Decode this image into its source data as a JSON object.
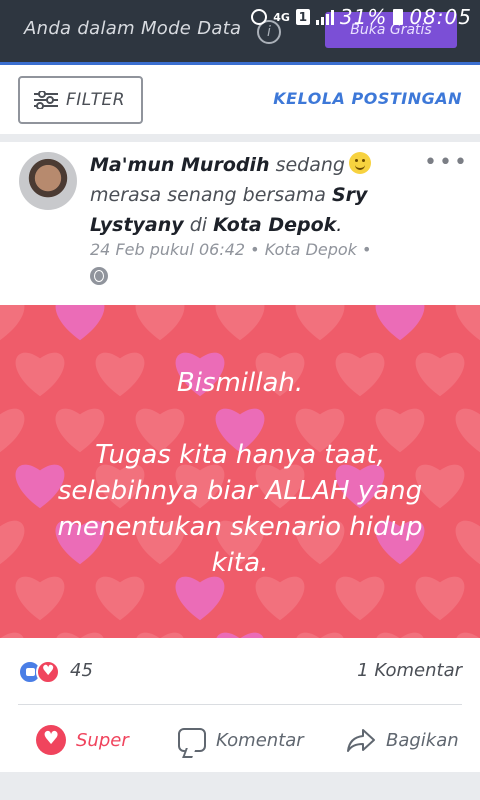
{
  "banner": {
    "mode_text": "Anda dalam Mode Data",
    "info_icon": "info-icon",
    "free_button": "Buka Gratis"
  },
  "status_bar": {
    "network": "4G",
    "sim": "1",
    "battery_percent": "31%",
    "time": "08:05"
  },
  "toolbar": {
    "filter_label": "FILTER",
    "manage_label": "KELOLA POSTINGAN"
  },
  "post": {
    "author": "Ma'mun Murodih",
    "activity_prefix": "sedang",
    "feeling_text": "merasa senang bersama",
    "tagged_person": "Sry Lystyany",
    "place_prefix": "di",
    "place": "Kota Depok",
    "period": ".",
    "meta": "24 Feb pukul 06:42 • Kota Depok •",
    "image_text": {
      "line1": "Bismillah.",
      "line2": "Tugas kita hanya taat,",
      "line3": "selebihnya biar ALLAH yang",
      "line4": "menentukan skenario hidup",
      "line5": "kita."
    },
    "image_colors": {
      "background": "#ef5c6a",
      "heart_red": "#f47a86",
      "heart_pink": "#ea6fc4"
    },
    "reaction_count": "45",
    "comment_count": "1 Komentar"
  },
  "actions": {
    "super_label": "Super",
    "comment_label": "Komentar",
    "share_label": "Bagikan"
  }
}
